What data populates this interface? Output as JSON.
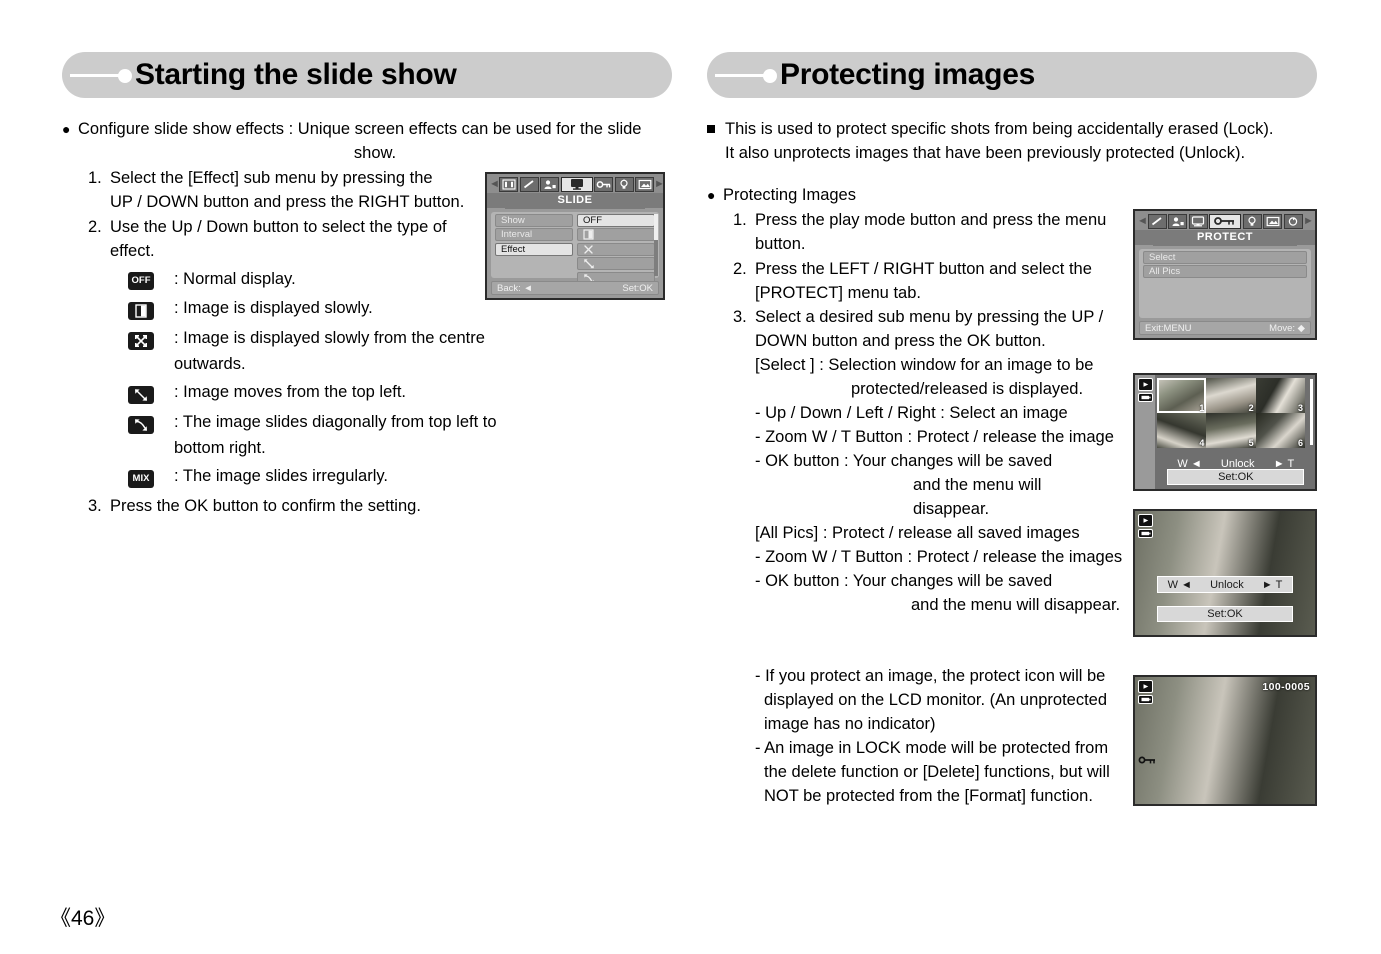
{
  "page": {
    "number": "《46》"
  },
  "left": {
    "header": {
      "title": "Starting the slide show"
    },
    "intro": {
      "line1": "Configure slide show effects : Unique screen effects can be used for the slide",
      "line2": "show."
    },
    "steps": [
      {
        "num": "1.",
        "lines": [
          "Select the [Effect] sub menu by pressing the",
          "UP / DOWN button and press the RIGHT button."
        ]
      },
      {
        "num": "2.",
        "lines": [
          "Use the Up / Down button to select the type of",
          "effect."
        ]
      }
    ],
    "effects": [
      {
        "icon": "off-icon",
        "label": "OFF",
        "text": ": Normal display."
      },
      {
        "icon": "fade-icon",
        "label": "",
        "text": ": Image is displayed slowly."
      },
      {
        "icon": "expand-icon",
        "label": "",
        "text": ": Image is displayed slowly from the centre",
        "cont": "outwards."
      },
      {
        "icon": "slide-in-icon",
        "label": "",
        "text": ": Image moves from the top left."
      },
      {
        "icon": "diagonal-icon",
        "label": "",
        "text": ": The image slides diagonally from top left to",
        "cont": "bottom right."
      },
      {
        "icon": "mix-icon",
        "label": "MIX",
        "text": ": The image slides irregularly."
      }
    ],
    "step3": {
      "num": "3.",
      "text": "Press the OK button to confirm the setting."
    },
    "lcd_slide": {
      "title": "SLIDE",
      "tabs": [
        "size-icon",
        "quality-icon",
        "timer-icon",
        "slide-icon",
        "key-icon",
        "bulb-icon",
        "resize-icon"
      ],
      "selected_tab_index": 3,
      "rows": [
        {
          "label": "Show",
          "value": "OFF",
          "value_icon": "",
          "label_active": false,
          "value_active": true
        },
        {
          "label": "Interval",
          "value": "",
          "value_icon": "fade-icon",
          "label_active": false,
          "value_active": false
        },
        {
          "label": "Effect",
          "value": "",
          "value_icon": "expand-icon",
          "label_active": true,
          "value_active": false
        },
        {
          "label": "",
          "value": "",
          "value_icon": "slide-in-icon",
          "label_active": false,
          "value_active": false
        },
        {
          "label": "",
          "value": "",
          "value_icon": "diagonal-icon",
          "label_active": false,
          "value_active": false
        }
      ],
      "status_left": "Back: ◄",
      "status_right": "Set:OK"
    }
  },
  "right": {
    "header": {
      "title": "Protecting images"
    },
    "intro": {
      "line1": "This is used to protect specific shots from being accidentally erased (Lock).",
      "line2": "It also unprotects images that have been previously protected (Unlock)."
    },
    "section_title": "Protecting Images",
    "steps": [
      {
        "num": "1.",
        "lines": [
          "Press the play mode button and press the menu",
          "button."
        ]
      },
      {
        "num": "2.",
        "lines": [
          "Press the LEFT / RIGHT button and select the",
          "[PROTECT] menu tab."
        ]
      },
      {
        "num": "3.",
        "lines": [
          "Select a desired sub menu by pressing the UP /",
          "DOWN button and press the OK button."
        ]
      }
    ],
    "select_block": [
      {
        "indent": 1,
        "text": "[Select ] : Selection window for an image to be"
      },
      {
        "indent": 2,
        "text": "protected/released is displayed."
      },
      {
        "indent": 1,
        "text": "- Up / Down / Left / Right : Select an image"
      },
      {
        "indent": 1,
        "text": "- Zoom W / T Button  : Protect / release the image"
      },
      {
        "indent": 1,
        "text": "- OK button                   : Your changes will be saved"
      },
      {
        "indent": 2,
        "text": "and the menu will"
      },
      {
        "indent": 2,
        "text": "disappear."
      },
      {
        "indent": 1,
        "text": "[All Pics] : Protect / release all saved images"
      },
      {
        "indent": 1,
        "text": "- Zoom W / T Button : Protect / release the images"
      },
      {
        "indent": 1,
        "text": "- OK button                 : Your changes will be saved"
      },
      {
        "indent": 2,
        "text": "and the menu will disappear."
      }
    ],
    "notes": [
      {
        "indent": 1,
        "text": "- If you protect an image, the protect icon will be"
      },
      {
        "indent": 1,
        "text": "displayed on the LCD monitor. (An unprotected"
      },
      {
        "indent": 1,
        "text": "image has no indicator)"
      },
      {
        "indent": 1,
        "text": "- An image in LOCK mode will be protected from"
      },
      {
        "indent": 1,
        "text": "the delete function or [Delete] functions, but will"
      },
      {
        "indent": 1,
        "text": "NOT be protected from the [Format] function."
      }
    ],
    "lcd_protect": {
      "title": "PROTECT",
      "tabs": [
        "quality-icon",
        "timer-icon",
        "slide-icon",
        "key-icon",
        "bulb-icon",
        "resize-icon",
        "rotate-icon"
      ],
      "selected_tab_index": 3,
      "rows": [
        {
          "label": "Select",
          "label_active": false
        },
        {
          "label": "All Pics",
          "label_active": false
        }
      ],
      "status_left": "Exit:MENU",
      "status_right": "Move: ◆"
    },
    "lcd_thumbs": {
      "thumbs": [
        "1",
        "2",
        "3",
        "4",
        "5",
        "6"
      ],
      "selected_index": 0,
      "zoom_w": "W ◄",
      "state": "Unlock",
      "zoom_t": "► T",
      "setok": "Set:OK"
    },
    "lcd_single": {
      "zoom_w": "W ◄",
      "state": "Unlock",
      "zoom_t": "► T",
      "setok": "Set:OK"
    },
    "lcd_locked": {
      "filenum": "100-0005"
    }
  },
  "colors": {
    "header_bg": "#cccccc",
    "lcd_border": "#2b2b2b",
    "lcd_bg": "#9a9a9a",
    "menu_bg": "#b4b4b4",
    "tab_selected": "#e6e6e6",
    "text": "#000000"
  }
}
